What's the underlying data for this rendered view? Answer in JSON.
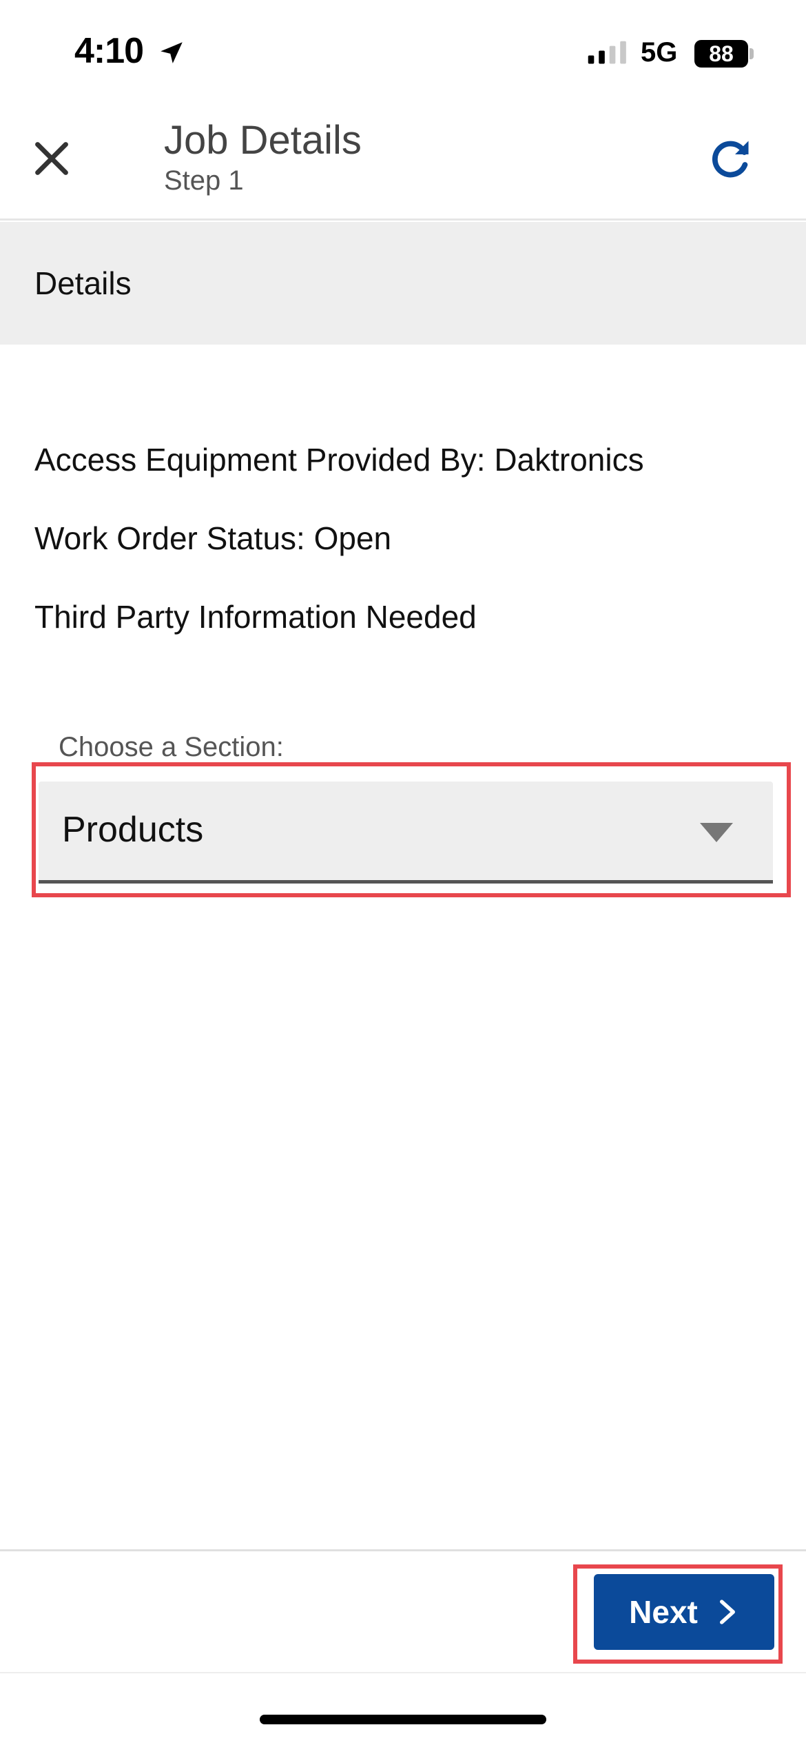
{
  "status_bar": {
    "time": "4:10",
    "network": "5G",
    "battery": "88"
  },
  "header": {
    "title": "Job Details",
    "subtitle": "Step 1"
  },
  "section": {
    "label": "Details"
  },
  "details": [
    "Access Equipment Provided By: Daktronics",
    "Work Order Status: Open",
    "Third Party Information Needed"
  ],
  "section_picker": {
    "label": "Choose a Section:",
    "value": "Products"
  },
  "footer": {
    "next_label": "Next"
  },
  "colors": {
    "primary": "#0b4a9a",
    "highlight": "#e8474d",
    "section_bg": "#eeeeee"
  }
}
